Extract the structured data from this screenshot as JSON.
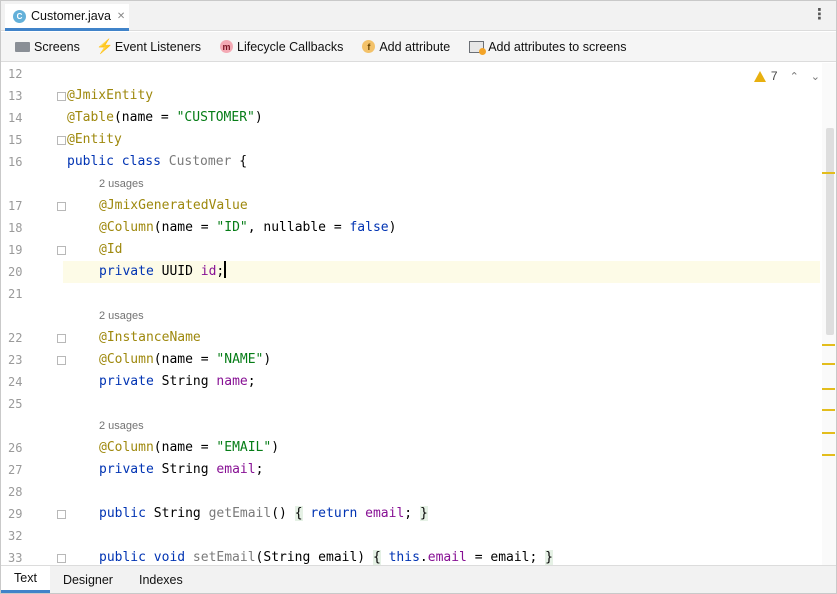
{
  "tab": {
    "icon": "class-icon",
    "icon_letter": "C",
    "file_name": "Customer.java",
    "close_symbol": "✕"
  },
  "toolbar": {
    "items": [
      {
        "label": "Screens",
        "icon": "screens-icon"
      },
      {
        "label": "Event Listeners",
        "icon": "lightning-icon"
      },
      {
        "label": "Lifecycle Callbacks",
        "icon": "method-icon",
        "icon_letter": "m"
      },
      {
        "label": "Add attribute",
        "icon": "field-icon",
        "icon_letter": "f"
      },
      {
        "label": "Add attributes to screens",
        "icon": "attributes-to-screens-icon"
      }
    ]
  },
  "inspections": {
    "warning_count": "7"
  },
  "code": {
    "l12": "12",
    "l13": "13",
    "l14": "14",
    "l15": "15",
    "l16": "16",
    "l17": "17",
    "l18": "18",
    "l19": "19",
    "l20": "20",
    "l21": "21",
    "l22": "22",
    "l23": "23",
    "l24": "24",
    "l25": "25",
    "l26": "26",
    "l27": "27",
    "l28": "28",
    "l29": "29",
    "l32": "32",
    "l33": "33",
    "usages": "2 usages",
    "t13_ann": "@JmixEntity",
    "t14_ann": "@Table",
    "t14_a": "(name = ",
    "t14_s": "\"CUSTOMER\"",
    "t14_b": ")",
    "t15_ann": "@Entity",
    "t16_kw": "public class ",
    "t16_name": "Customer",
    "t16_b": " {",
    "t17_ann": "@JmixGeneratedValue",
    "t18_ann": "@Column",
    "t18_a": "(name = ",
    "t18_s": "\"ID\"",
    "t18_b": ", nullable = ",
    "t18_kw": "false",
    "t18_c": ")",
    "t19_ann": "@Id",
    "t20_kw": "private ",
    "t20_type": "UUID ",
    "t20_fld": "id",
    "t20_end": ";",
    "t22_ann": "@InstanceName",
    "t23_ann": "@Column",
    "t23_a": "(name = ",
    "t23_s": "\"NAME\"",
    "t23_b": ")",
    "t24_kw": "private ",
    "t24_type": "String ",
    "t24_fld": "name",
    "t24_end": ";",
    "t26_ann": "@Column",
    "t26_a": "(name = ",
    "t26_s": "\"EMAIL\"",
    "t26_b": ")",
    "t27_kw": "private ",
    "t27_type": "String ",
    "t27_fld": "email",
    "t27_end": ";",
    "t29_kw": "public ",
    "t29_type": "String ",
    "t29_m": "getEmail",
    "t29_a": "() ",
    "t29_ob": "{",
    "t29_kw2": " return ",
    "t29_fld": "email",
    "t29_semi": "; ",
    "t29_cb": "}",
    "t33_kw": "public void ",
    "t33_m": "setEmail",
    "t33_a": "(String email) ",
    "t33_ob": "{",
    "t33_kw2": " this",
    "t33_dot": ".",
    "t33_fld": "email",
    "t33_b": " = email",
    "t33_semi": "; ",
    "t33_cb": "}"
  },
  "bottom_tabs": [
    {
      "label": "Text",
      "active": true
    },
    {
      "label": "Designer"
    },
    {
      "label": "Indexes"
    }
  ]
}
